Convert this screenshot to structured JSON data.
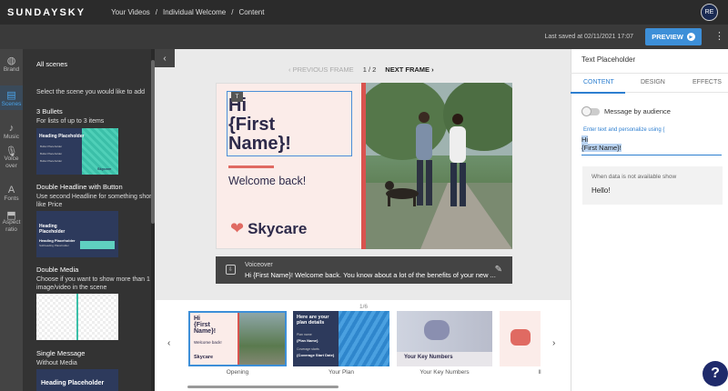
{
  "app": {
    "logo": "SUNDAYSKY",
    "avatar": "RE"
  },
  "breadcrumb": [
    "Your Videos",
    "/",
    "Individual Welcome",
    "/",
    "Content"
  ],
  "toolbar": {
    "saved": "Last saved at 02/11/2021 17:07",
    "preview": "PREVIEW",
    "more": "⋮"
  },
  "rail": [
    {
      "label": "Brand",
      "icon": "palette-icon"
    },
    {
      "label": "Scenes",
      "icon": "scenes-icon"
    },
    {
      "label": "Music",
      "icon": "music-icon"
    },
    {
      "label": "Voice over",
      "icon": "mic-icon"
    },
    {
      "label": "Fonts",
      "icon": "fonts-icon"
    },
    {
      "label": "Aspect ratio",
      "icon": "aspect-icon"
    }
  ],
  "scenes_panel": {
    "title": "All scenes",
    "hint": "Select the scene you would like to add",
    "items": [
      {
        "title": "3 Bullets",
        "desc": "For lists of up to 3 items",
        "thumb_heading": "Heading Placeholder",
        "bullets": [
          "Bullet Placeholder",
          "Bullet Placeholder",
          "Bullet Placeholder"
        ],
        "brand": "Skycare"
      },
      {
        "title": "Double Headline with Button",
        "desc": "Use second Headline for something short like Price",
        "thumb_heading": "Heading Placeholder",
        "thumb_sub": "Heading Placeholder",
        "thumb_sub2": "Subheading Placeholder"
      },
      {
        "title": "Double Media",
        "desc": "Choose if you want to show more than 1 image/video in the scene"
      },
      {
        "title": "Single Message",
        "desc": "Without Media",
        "thumb_heading": "Heading Placeholder"
      }
    ]
  },
  "canvas": {
    "prev": "‹ PREVIOUS FRAME",
    "page": "1 / 2",
    "next": "NEXT FRAME ›",
    "headline_line1": "Hi",
    "headline_line2": "{First",
    "headline_line3": "Name}!",
    "welcome": "Welcome back!",
    "brand": "Skycare",
    "voiceover_label": "Voiceover",
    "voiceover_text": "Hi {First Name}! Welcome back. You know about a lot of the benefits of your new ..."
  },
  "filmstrip": {
    "count": "1/6",
    "items": [
      {
        "caption": "Opening",
        "l1": "Hi",
        "l2": "{First",
        "l3": "Name}!",
        "sub": "Welcome back!",
        "brand": "Skycare"
      },
      {
        "caption": "Your Plan",
        "head": "Here are your plan details",
        "f1": "Plan name",
        "v1": "{Plan Name}",
        "f2": "Coverage starts",
        "v2": "{Coverage Start Date}"
      },
      {
        "caption": "Your Key Numbers",
        "head": "Your Key Numbers"
      },
      {
        "caption": "Il"
      }
    ]
  },
  "right_panel": {
    "title": "Text Placeholder",
    "tabs": [
      "CONTENT",
      "DESIGN",
      "EFFECTS"
    ],
    "toggle_label": "Message by audience",
    "enter_label": "Enter text and personalize using {",
    "editor_line1": "Hi",
    "editor_line2": "{First Name}!",
    "fallback_label": "When data is not available show",
    "fallback_value": "Hello!"
  },
  "help": "?"
}
